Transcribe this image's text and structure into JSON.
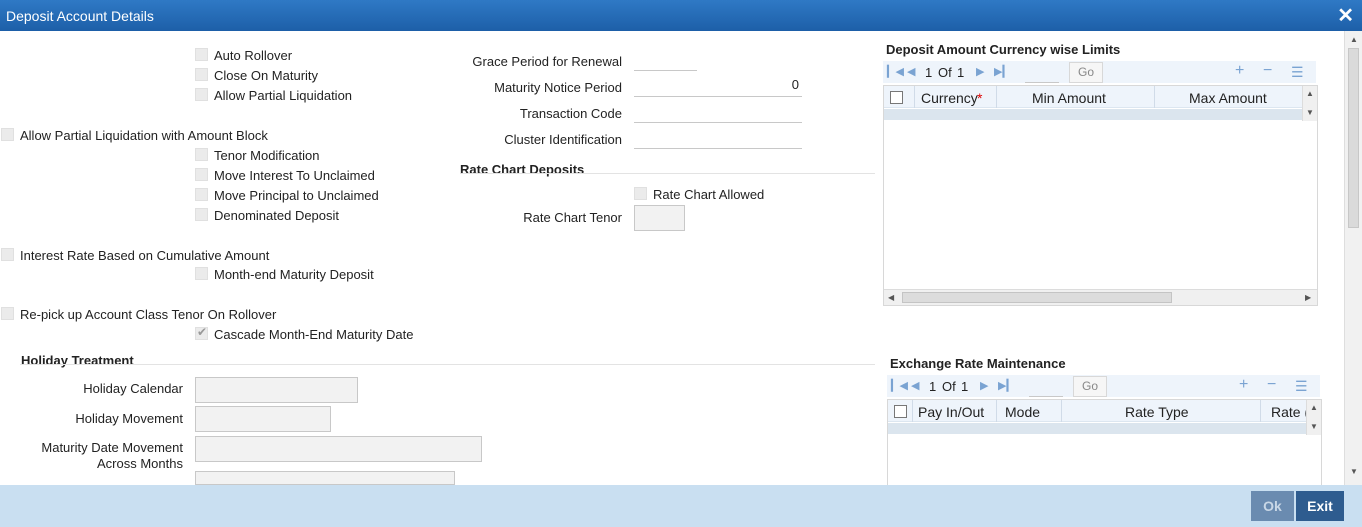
{
  "window": {
    "title": "Deposit Account Details",
    "close_glyph": "✕"
  },
  "flags": {
    "auto_rollover": "Auto Rollover",
    "close_on_maturity": "Close On Maturity",
    "allow_partial_liquidation": "Allow Partial Liquidation",
    "allow_partial_liquidation_with_block": "Allow Partial Liquidation with Amount Block",
    "tenor_modification": "Tenor Modification",
    "move_interest_to_unclaimed": "Move Interest To Unclaimed",
    "move_principal_to_unclaimed": "Move Principal to Unclaimed",
    "denominated_deposit": "Denominated Deposit",
    "interest_rate_cumulative": "Interest Rate Based on Cumulative Amount",
    "month_end_maturity_deposit": "Month-end Maturity Deposit",
    "repick_tenor_on_rollover": "Re-pick up Account Class Tenor On Rollover",
    "cascade_month_end": "Cascade Month-End Maturity Date",
    "cascade_checked": true
  },
  "fields": {
    "grace_period_label": "Grace Period for Renewal",
    "grace_period_value": "",
    "maturity_notice_label": "Maturity Notice Period",
    "maturity_notice_value": "0",
    "transaction_code_label": "Transaction Code",
    "transaction_code_value": "",
    "cluster_id_label": "Cluster Identification",
    "cluster_id_value": ""
  },
  "rate_chart": {
    "section_title": "Rate Chart Deposits",
    "allowed_label": "Rate Chart Allowed",
    "tenor_label": "Rate Chart Tenor"
  },
  "holiday": {
    "section_title": "Holiday Treatment",
    "calendar_label": "Holiday Calendar",
    "movement_label": "Holiday Movement",
    "maturity_move_label_1": "Maturity Date Movement",
    "maturity_move_label_2": "Across Months"
  },
  "currency_limits": {
    "title": "Deposit Amount Currency wise Limits",
    "page_current": "1",
    "page_of": "Of",
    "page_total": "1",
    "go_label": "Go",
    "columns": [
      "Currency",
      "Min Amount",
      "Max Amount"
    ],
    "required_marker": "*"
  },
  "exchange_rate": {
    "title": "Exchange Rate Maintenance",
    "page_current": "1",
    "page_of": "Of",
    "page_total": "1",
    "go_label": "Go",
    "columns": [
      "Pay In/Out",
      "Mode",
      "Rate Type",
      "Rate ("
    ]
  },
  "buttons": {
    "ok": "Ok",
    "exit": "Exit"
  },
  "colors": {
    "titlebar": "#2f79c5",
    "footer": "#c9dff1",
    "exit_button": "#2e5c8f",
    "grid_header": "#eef4fb"
  }
}
